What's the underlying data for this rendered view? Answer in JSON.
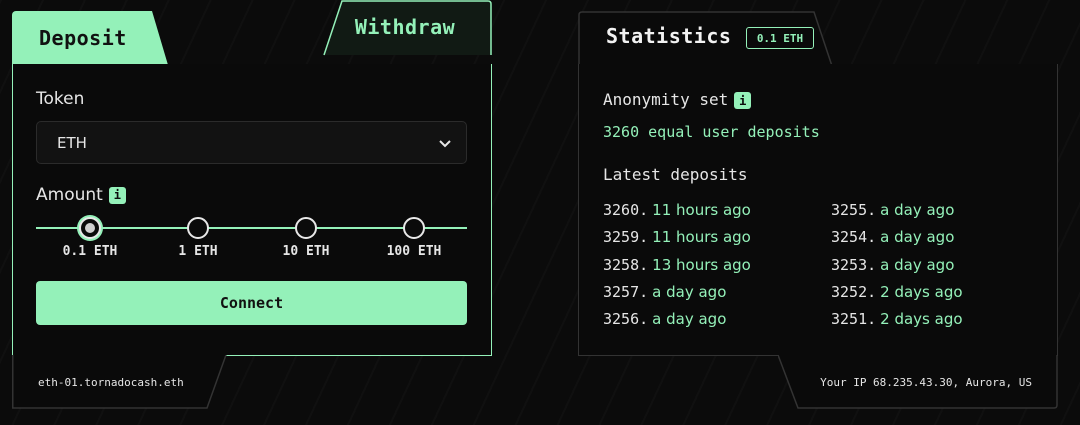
{
  "tabs": {
    "deposit": "Deposit",
    "withdraw": "Withdraw"
  },
  "token": {
    "label": "Token",
    "selected": "ETH"
  },
  "amount": {
    "label": "Amount",
    "info": "i",
    "options": [
      "0.1 ETH",
      "1 ETH",
      "10 ETH",
      "100 ETH"
    ],
    "selected_index": 0
  },
  "connect_label": "Connect",
  "footer_left": "eth-01.tornadocash.eth",
  "statistics": {
    "title": "Statistics",
    "badge": "0.1 ETH",
    "anonymity_label": "Anonymity set",
    "anonymity_info": "i",
    "anonymity_value": "3260 equal user deposits",
    "latest_label": "Latest deposits",
    "deposits_left": [
      {
        "id": "3260.",
        "ago": "11 hours ago"
      },
      {
        "id": "3259.",
        "ago": "11 hours ago"
      },
      {
        "id": "3258.",
        "ago": "13 hours ago"
      },
      {
        "id": "3257.",
        "ago": "a day ago"
      },
      {
        "id": "3256.",
        "ago": "a day ago"
      }
    ],
    "deposits_right": [
      {
        "id": "3255.",
        "ago": "a day ago"
      },
      {
        "id": "3254.",
        "ago": "a day ago"
      },
      {
        "id": "3253.",
        "ago": "a day ago"
      },
      {
        "id": "3252.",
        "ago": "2 days ago"
      },
      {
        "id": "3251.",
        "ago": "2 days ago"
      }
    ]
  },
  "footer_right": "Your IP 68.235.43.30, Aurora, US",
  "colors": {
    "accent": "#94f1b9",
    "background": "#0b0b0b",
    "border_muted": "#333333"
  }
}
